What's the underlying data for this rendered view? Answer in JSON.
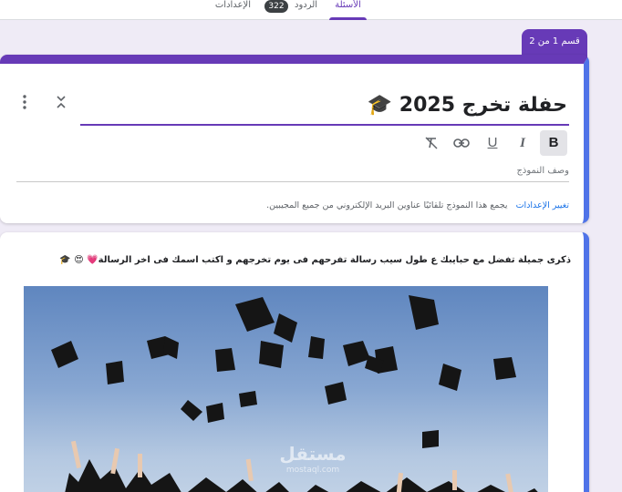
{
  "tabs": {
    "questions": "الأسئلة",
    "responses": "الردود",
    "responses_count": "322",
    "settings": "الإعدادات"
  },
  "section": {
    "label": "قسم 1 من 2"
  },
  "form": {
    "title": "حفلة تخرج 2025 🎓",
    "description_placeholder": "وصف النموذج",
    "email_note": "يجمع هذا النموذج تلقائيًا عناوين البريد الإلكتروني من جميع المجيبين.",
    "change_settings_link": "تغيير الإعدادات"
  },
  "toolbar": {
    "bold": "B",
    "italic": "I",
    "underline": "U",
    "link": "link-icon",
    "clear": "clear-format-icon"
  },
  "content": {
    "text": "ذكرى جميلة تفضل مع حبايبك ع طول سيب رسالة تفرحهم فى يوم تخرجهم و اكتب اسمك فى اخر الرسالة💗 😍 🎓"
  },
  "watermark": {
    "main": "مستقل",
    "sub": "mostaql.com"
  },
  "colors": {
    "accent": "#673ab7",
    "side_accent": "#4f73e8",
    "background": "#efebf6",
    "link": "#1a73e8"
  }
}
